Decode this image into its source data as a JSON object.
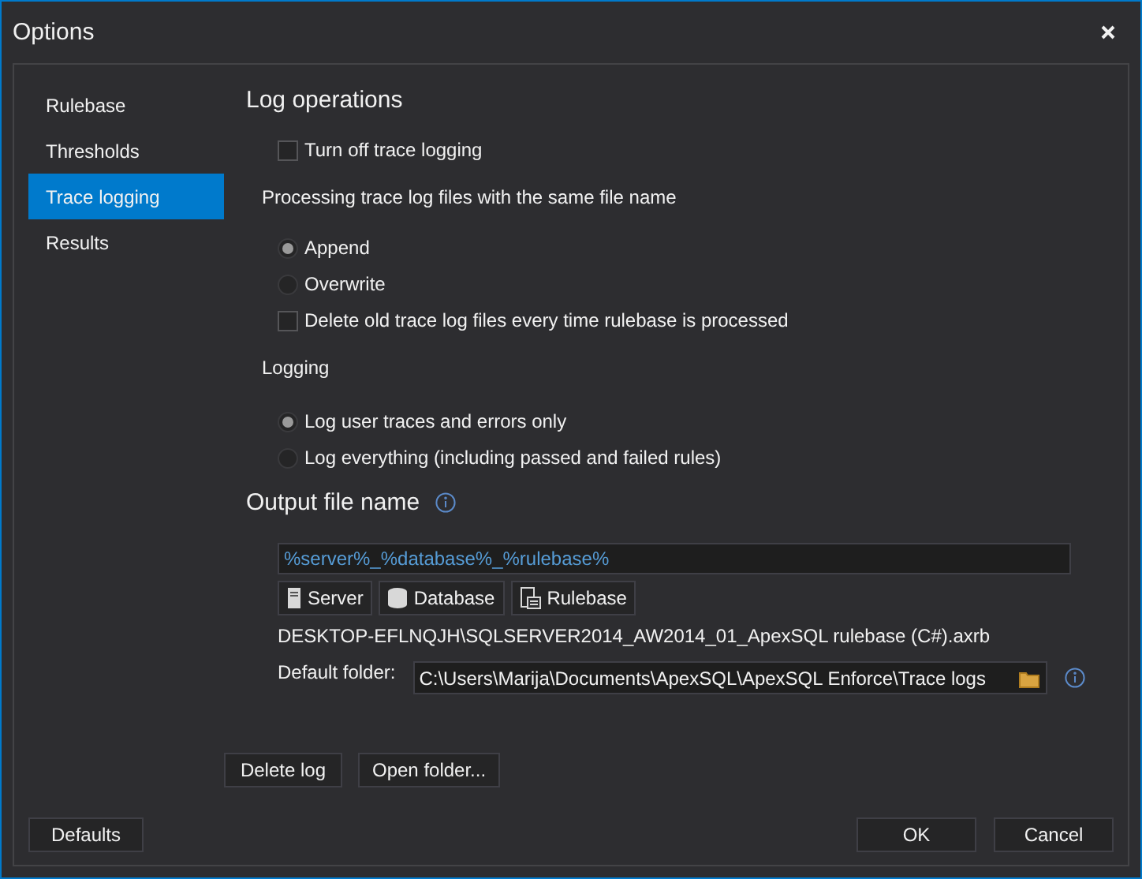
{
  "window": {
    "title": "Options"
  },
  "sidebar": {
    "items": [
      {
        "label": "Rulebase",
        "selected": false
      },
      {
        "label": "Thresholds",
        "selected": false
      },
      {
        "label": "Trace logging",
        "selected": true
      },
      {
        "label": "Results",
        "selected": false
      }
    ]
  },
  "log_operations": {
    "heading": "Log operations",
    "turn_off": {
      "label": "Turn off trace logging",
      "checked": false
    },
    "processing_label": "Processing trace log files with the same file name",
    "processing_options": [
      {
        "label": "Append",
        "selected": true
      },
      {
        "label": "Overwrite",
        "selected": false
      }
    ],
    "delete_old": {
      "label": "Delete old trace log files every time rulebase is processed",
      "checked": false
    },
    "logging_label": "Logging",
    "logging_options": [
      {
        "label": "Log user traces and errors only",
        "selected": true
      },
      {
        "label": "Log everything (including passed and failed rules)",
        "selected": false
      }
    ]
  },
  "output": {
    "heading": "Output file name",
    "pattern_value": "%server%_%database%_%rulebase%",
    "token_buttons": [
      {
        "label": "Server",
        "kind": "server"
      },
      {
        "label": "Database",
        "kind": "database"
      },
      {
        "label": "Rulebase",
        "kind": "rulebase"
      }
    ],
    "resolved_name": "DESKTOP-EFLNQJH\\SQLSERVER2014_AW2014_01_ApexSQL rulebase (C#).axrb",
    "default_folder_label": "Default folder:",
    "default_folder_value": "C:\\Users\\Marija\\Documents\\ApexSQL\\ApexSQL Enforce\\Trace logs"
  },
  "actions": [
    "Delete log",
    "Open folder..."
  ],
  "footer": {
    "left": [
      "Defaults"
    ],
    "right": [
      "OK",
      "Cancel"
    ]
  }
}
